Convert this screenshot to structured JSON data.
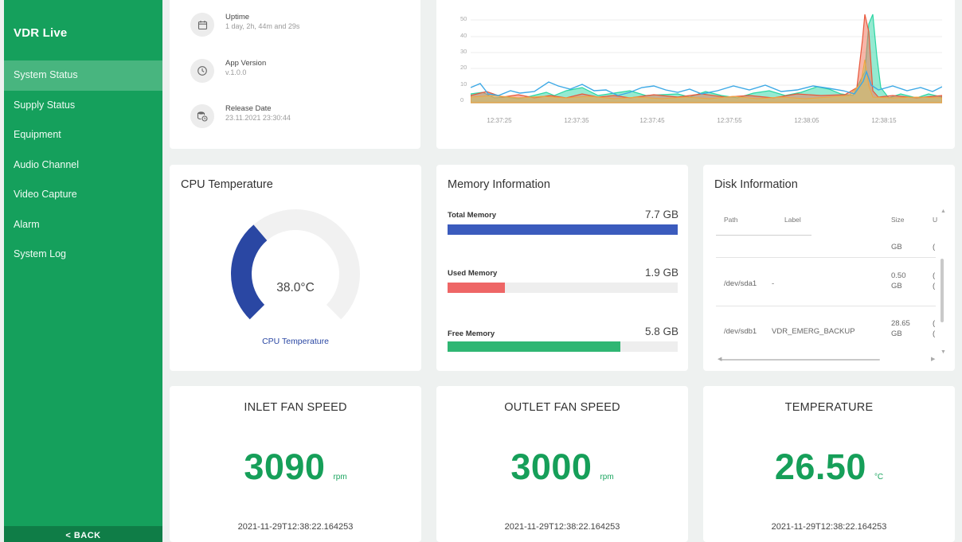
{
  "sidebar": {
    "brand": "VDR Live",
    "items": [
      {
        "label": "System Status"
      },
      {
        "label": "Supply Status"
      },
      {
        "label": "Equipment"
      },
      {
        "label": "Audio Channel"
      },
      {
        "label": "Video Capture"
      },
      {
        "label": "Alarm"
      },
      {
        "label": "System Log"
      }
    ],
    "back_label": "< BACK"
  },
  "info": {
    "uptime_label": "Uptime",
    "uptime_value": "1 day, 2h, 44m and 29s",
    "app_version_label": "App Version",
    "app_version_value": "v.1.0.0",
    "release_date_label": "Release Date",
    "release_date_value": "23.11.2021 23:30:44"
  },
  "load_chart": {
    "y_ticks": [
      "50",
      "40",
      "30",
      "20",
      "10",
      "0"
    ],
    "x_ticks": [
      "12:37:25",
      "12:37:35",
      "12:37:45",
      "12:37:55",
      "12:38:05",
      "12:38:15"
    ]
  },
  "cpu": {
    "title": "CPU Temperature",
    "value": "38.0°C",
    "caption": "CPU Temperature",
    "fraction": 0.35,
    "color": "#2a47a3"
  },
  "memory": {
    "title": "Memory Information",
    "rows": [
      {
        "label": "Total Memory",
        "value": "7.7 GB",
        "fraction": 1.0,
        "color": "#3b5bbd"
      },
      {
        "label": "Used Memory",
        "value": "1.9 GB",
        "fraction": 0.25,
        "color": "#ee6666"
      },
      {
        "label": "Free Memory",
        "value": "5.8 GB",
        "fraction": 0.75,
        "color": "#2fb673"
      }
    ]
  },
  "disk": {
    "title": "Disk Information",
    "columns": [
      "Path",
      "Label",
      "Size",
      "U"
    ],
    "partial_row": {
      "size": "GB",
      "extra": "("
    },
    "rows": [
      {
        "path": "/dev/sda1",
        "label": "-",
        "size_num": "0.50",
        "size_unit": "GB",
        "extra1": "(",
        "extra2": "("
      },
      {
        "path": "/dev/sdb1",
        "label": "VDR_EMERG_BACKUP",
        "size_num": "28.65",
        "size_unit": "GB",
        "extra1": "(",
        "extra2": "("
      }
    ]
  },
  "metrics": [
    {
      "title": "INLET FAN SPEED",
      "value": "3090",
      "unit": "rpm",
      "timestamp": "2021-11-29T12:38:22.164253"
    },
    {
      "title": "OUTLET FAN SPEED",
      "value": "3000",
      "unit": "rpm",
      "timestamp": "2021-11-29T12:38:22.164253"
    },
    {
      "title": "TEMPERATURE",
      "value": "26.50",
      "unit": "°C",
      "timestamp": "2021-11-29T12:38:22.164253"
    }
  ]
}
